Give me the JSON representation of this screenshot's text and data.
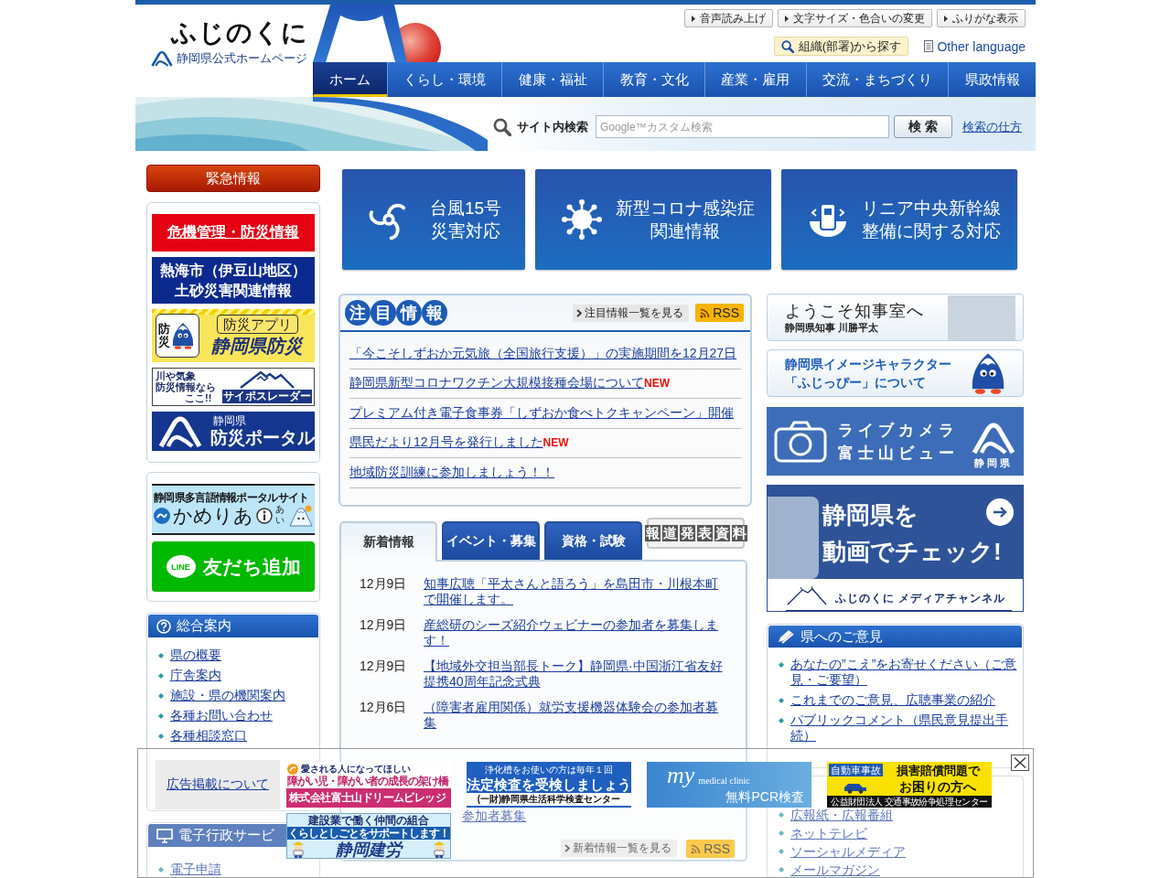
{
  "header": {
    "site_title": "ふじのくに",
    "site_subtitle": "静岡県公式ホームページ",
    "utility_buttons": [
      "音声読み上げ",
      "文字サイズ・色合いの変更",
      "ふりがな表示"
    ],
    "org_search": "組織(部署)から探す",
    "other_language": "Other language"
  },
  "nav": [
    {
      "label": "ホーム",
      "selected": true
    },
    {
      "label": "くらし・環境",
      "selected": false
    },
    {
      "label": "健康・福祉",
      "selected": false
    },
    {
      "label": "教育・文化",
      "selected": false
    },
    {
      "label": "産業・雇用",
      "selected": false
    },
    {
      "label": "交流・まちづくり",
      "selected": false
    },
    {
      "label": "県政情報",
      "selected": false
    }
  ],
  "site_search": {
    "label": "サイト内検索",
    "placeholder": "Google™カスタム検索",
    "button": "検 索",
    "help_link": "検索の仕方"
  },
  "left_column": {
    "emergency_button": "緊急情報",
    "disaster_banners": [
      {
        "kind": "alert",
        "lines": [
          "危機管理・防災情報"
        ]
      },
      {
        "kind": "notice",
        "lines": [
          "熱海市（伊豆山地区）",
          "土砂災害関連情報"
        ]
      },
      {
        "kind": "app",
        "tile_text": "防災",
        "lines": [
          "防災アプリ",
          "静岡県防災"
        ]
      },
      {
        "kind": "radar",
        "lines": [
          "川や気象",
          "防災情報なら",
          "ここ!!"
        ],
        "tag": "サイポスレーダー"
      },
      {
        "kind": "portal",
        "lines": [
          "静岡県",
          "防災ポータル"
        ]
      }
    ],
    "service_banners": [
      {
        "kind": "multilingual",
        "lines": [
          "静岡県多言語情報ポータルサイト",
          "かめりあ"
        ],
        "tag": "あい"
      },
      {
        "kind": "line",
        "lines": [
          "友だち追加"
        ],
        "tag": "LINE"
      }
    ],
    "guide": {
      "title": "総合案内",
      "links": [
        "県の概要",
        "庁舎案内",
        "施設・県の機関案内",
        "各種お問い合わせ",
        "各種相談窓口"
      ]
    },
    "e_services": {
      "title": "電子行政サービ",
      "links": [
        "電子申請"
      ]
    }
  },
  "feature_banners": [
    {
      "kind": "typhoon",
      "lines": [
        "台風15号",
        "災害対応"
      ]
    },
    {
      "kind": "virus",
      "lines": [
        "新型コロナ感染症",
        "関連情報"
      ]
    },
    {
      "kind": "maglev",
      "lines": [
        "リニア中央新幹線",
        "整備に関する対応"
      ]
    }
  ],
  "featured": {
    "title": "注目情報",
    "list_link": "注目情報一覧を見る",
    "rss": "RSS",
    "items": [
      {
        "text": "「今こそしずおか元気旅（全国旅行支援）」の実施期間を12月27日"
      },
      {
        "text": "静岡県新型コロナワクチン大規模接種会場について",
        "badge": "NEW"
      },
      {
        "text": "プレミアム付き電子食事券「しずおか食べトクキャンペーン」開催"
      },
      {
        "text": "県民だより12月号を発行しました",
        "badge": "NEW"
      },
      {
        "text": "地域防災訓練に参加しましょう！！"
      }
    ]
  },
  "news": {
    "tabs": [
      {
        "label": "新着情報",
        "selected": true,
        "kind": "plain"
      },
      {
        "label": "イベント・募集",
        "selected": false,
        "kind": "plain"
      },
      {
        "label": "資格・試験",
        "selected": false,
        "kind": "plain"
      },
      {
        "label": "報道発表資料",
        "selected": false,
        "kind": "boxed"
      }
    ],
    "items": [
      {
        "date": "12月9日",
        "title": "知事広聴「平太さんと語ろう」を島田市・川根本町で開催します。"
      },
      {
        "date": "12月9日",
        "title": "産総研のシーズ紹介ウェビナーの参加者を募集します！"
      },
      {
        "date": "12月9日",
        "title": "【地域外交担当部長トーク】静岡県·中国浙江省友好提携40周年記念式典"
      },
      {
        "date": "12月6日",
        "title": "（障害者雇用関係）就労支援機器体験会の参加者募集"
      }
    ],
    "covered_fragment": "参加者募集",
    "list_link": "新着情報一覧を見る",
    "rss": "RSS"
  },
  "right_column": {
    "governor": {
      "title": "ようこそ知事室へ",
      "subtitle": "静岡県知事 川勝平太"
    },
    "mascot": {
      "lines": [
        "静岡県イメージキャラクター",
        "「ふじっぴー」について"
      ]
    },
    "live_camera": {
      "lines": [
        "ライブカメラ",
        "富士山ビュー"
      ],
      "logo_text": "静岡県"
    },
    "video": {
      "lines": [
        "静岡県を",
        "動画でチェック!"
      ],
      "channel": "ふじのくに メディアチャンネル"
    },
    "opinion": {
      "title": "県へのご意見",
      "links": [
        "あなたの”こえ”をお寄せください（ご意見・ご要望）",
        "これまでのご意見、広聴事業の紹介",
        "パブリックコメント（県民意見提出手続）"
      ]
    },
    "public_relations": {
      "links": [
        "広報紙・広報番組",
        "ネットテレビ",
        "ソーシャルメディア",
        "メールマガジン"
      ]
    }
  },
  "ad_bar": {
    "about_link": "広告掲載について",
    "ads": [
      {
        "kind": "welfare",
        "lines": [
          "愛される人になってほしい",
          "障がい児・障がい者の成長の架け橋",
          "株式会社富士山ドリームビレッジ"
        ]
      },
      {
        "kind": "inspection",
        "lines": [
          "浄化槽をお使いの方は毎年１回",
          "法定検査を受検しましょう",
          "(一財)静岡県生活科学検査センター"
        ]
      },
      {
        "kind": "clinic",
        "lines": [
          "my",
          "medical clinic",
          "無料PCR検査"
        ]
      },
      {
        "kind": "traffic",
        "lines": [
          "自動車事故",
          "損害賠償問題で",
          "お困りの方へ",
          "公益財団法人 交通事故紛争処理センター"
        ]
      },
      {
        "kind": "union",
        "lines": [
          "建設業で働く仲間の組合",
          "くらしとしごとをサポートします！",
          "静岡建労"
        ]
      }
    ]
  }
}
